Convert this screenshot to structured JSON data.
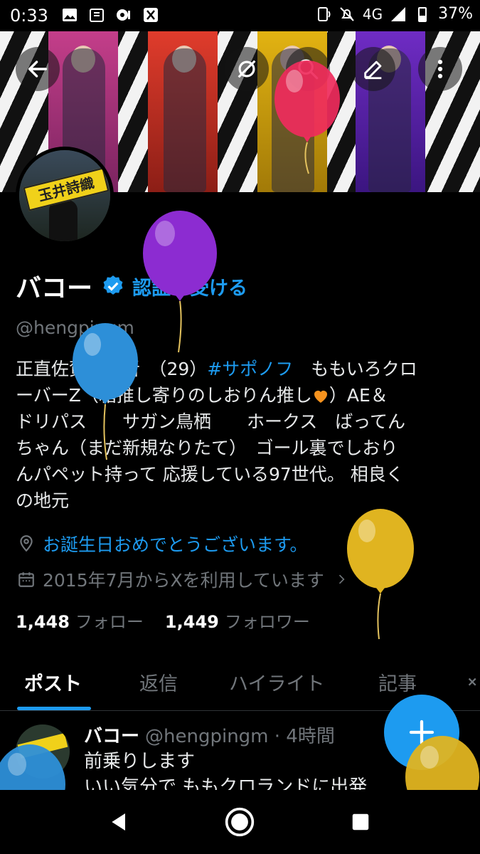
{
  "status_bar": {
    "time": "0:33",
    "network": "4G",
    "battery": "37%"
  },
  "banner": {
    "panel_colors": [
      "#c43e8a",
      "#e03c2c",
      "#e2b312",
      "#6f2cc4"
    ]
  },
  "avatar": {
    "sign_text": "玉井詩織"
  },
  "profile": {
    "name": "バコー",
    "get_verified": "認証を受ける",
    "handle": "@hengpingm",
    "bio_lines": [
      {
        "pre": "正直佐賀ノフ者　（29）",
        "hashtag": "#サポノフ",
        "post": "　ももいろクロ"
      },
      {
        "pre": "ーバーZ（箱推し寄りのしおりん推し",
        "post": "）AE＆"
      },
      {
        "text": "ドリパス　　サガン鳥栖　　ホークス　ばってん"
      },
      {
        "text": "ちゃん（まだ新規なりたて）　ゴール裏でしおり"
      },
      {
        "text": "んパペット持って 応援している97世代。 相良く"
      },
      {
        "text": "の地元"
      }
    ],
    "location": "お誕生日おめでとうございます。",
    "joined": "2015年7月からXを利用しています",
    "following_count": "1,448",
    "following_label": "フォロー",
    "followers_count": "1,449",
    "followers_label": "フォロワー"
  },
  "tabs": [
    "ポスト",
    "返信",
    "ハイライト",
    "記事"
  ],
  "post": {
    "author": "バコー",
    "meta": "@hengpingm · 4時間",
    "line1": "前乗りします",
    "line2": "いい気分で ももクロランドに出発"
  },
  "colors": {
    "accent": "#1d9bf0",
    "background": "#000000",
    "muted_text": "#71767b",
    "heart": "#f7931e"
  },
  "icons": {
    "back": "arrow-left-icon",
    "grok": "grok-icon",
    "search": "search-icon",
    "edit": "edit-icon",
    "more": "more-vertical-icon",
    "location": "location-pin-icon",
    "calendar": "calendar-icon",
    "compose": "plus-icon"
  }
}
